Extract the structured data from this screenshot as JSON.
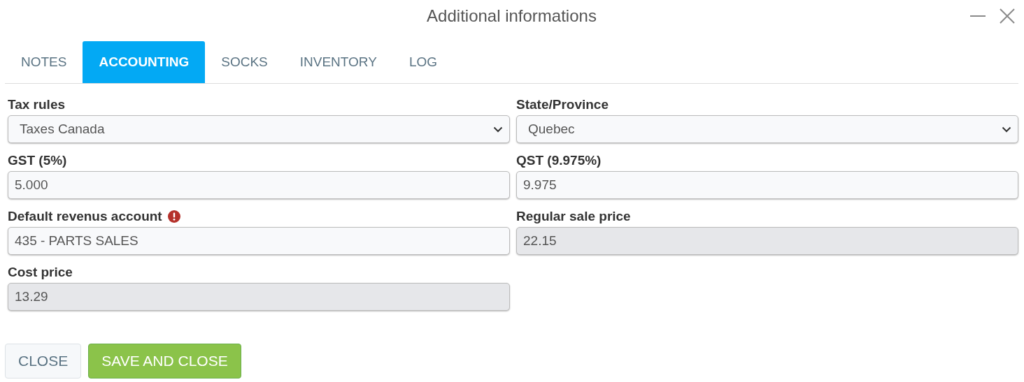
{
  "window": {
    "title": "Additional informations"
  },
  "tabs": [
    {
      "label": "NOTES",
      "selected": false
    },
    {
      "label": "ACCOUNTING",
      "selected": true
    },
    {
      "label": "SOCKS",
      "selected": false
    },
    {
      "label": "INVENTORY",
      "selected": false
    },
    {
      "label": "LOG",
      "selected": false
    }
  ],
  "fields": [
    {
      "label": "Tax rules",
      "kind": "select",
      "value": "Taxes Canada",
      "disabled": false,
      "warning": false
    },
    {
      "label": "State/Province",
      "kind": "select",
      "value": "Quebec",
      "disabled": false,
      "warning": false
    },
    {
      "label": "GST (5%)",
      "kind": "text",
      "value": "5.000",
      "disabled": false,
      "warning": false
    },
    {
      "label": "QST (9.975%)",
      "kind": "text",
      "value": "9.975",
      "disabled": false,
      "warning": false
    },
    {
      "label": "Default revenus account",
      "kind": "text",
      "value": "435 - PARTS SALES",
      "disabled": false,
      "warning": true
    },
    {
      "label": "Regular sale price",
      "kind": "text",
      "value": "22.15",
      "disabled": true,
      "warning": false
    },
    {
      "label": "Cost price",
      "kind": "text",
      "value": "13.29",
      "disabled": true,
      "warning": false
    }
  ],
  "buttons": [
    {
      "label": "CLOSE",
      "kind": "secondary"
    },
    {
      "label": "SAVE AND CLOSE",
      "kind": "primary"
    }
  ]
}
